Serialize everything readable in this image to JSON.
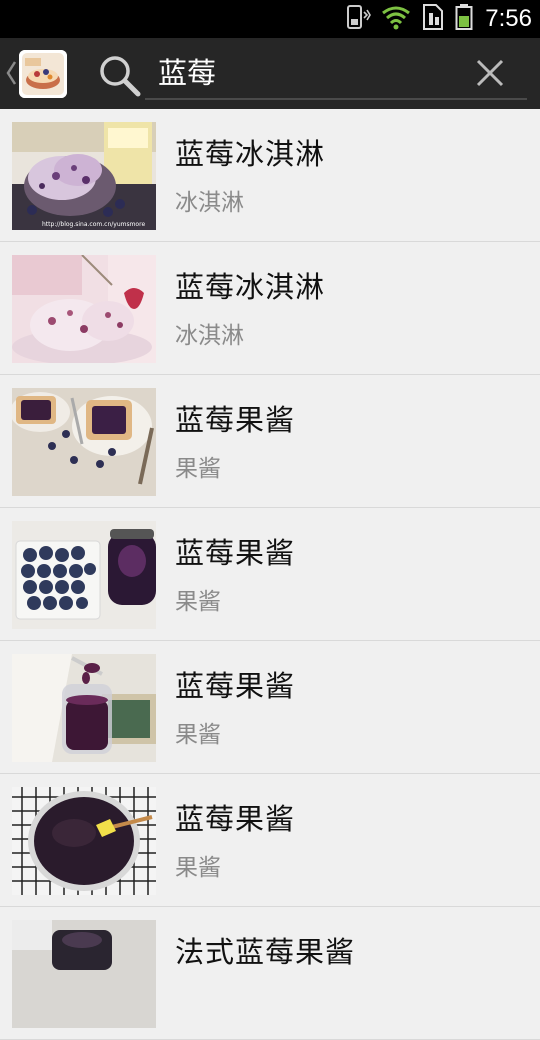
{
  "status_bar": {
    "time": "7:56",
    "icons": [
      "phone-vibrate-icon",
      "wifi-icon",
      "sim-card-icon",
      "battery-icon"
    ]
  },
  "search_bar": {
    "app_icon": "recipe-app-icon",
    "query": "蓝莓",
    "search_icon": "search-icon",
    "clear_icon": "close-icon"
  },
  "results": [
    {
      "title": "蓝莓冰淇淋",
      "category": "冰淇淋",
      "thumb_caption": "http://blog.sina.com.cn/yumsmore"
    },
    {
      "title": "蓝莓冰淇淋",
      "category": "冰淇淋"
    },
    {
      "title": "蓝莓果酱",
      "category": "果酱"
    },
    {
      "title": "蓝莓果酱",
      "category": "果酱"
    },
    {
      "title": "蓝莓果酱",
      "category": "果酱"
    },
    {
      "title": "蓝莓果酱",
      "category": "果酱"
    },
    {
      "title": "法式蓝莓果酱",
      "category": ""
    }
  ],
  "colors": {
    "header_bg": "#262626",
    "list_bg": "#f0f0f0",
    "divider": "#d9d9d9",
    "title_text": "#111111",
    "subtitle_text": "#8a8a8a"
  }
}
